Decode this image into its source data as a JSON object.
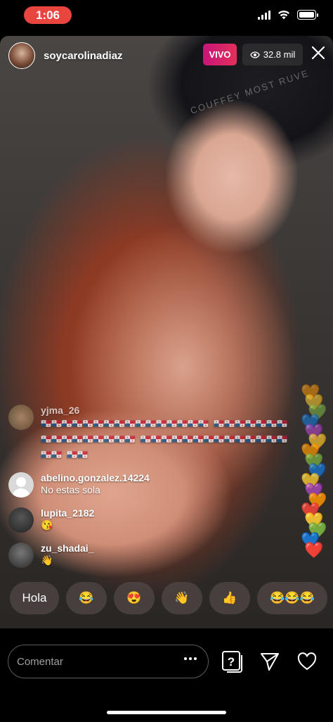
{
  "status": {
    "time": "1:06"
  },
  "stream": {
    "host_username": "soycarolinadiaz",
    "live_label": "VIVO",
    "viewer_count": "32.8 mil",
    "hat_text": "COUFFEY MOST RUVE"
  },
  "comments": [
    {
      "user": "yjma_26",
      "text": "🇵🇦🇵🇦🇵🇦🇵🇦🇵🇦🇵🇦🇵🇦🇵🇦🇵🇦🇵🇦🇵🇦🇵🇦🇵🇦🇵🇦🇵🇦🇵🇦 🇵🇦🇵🇦🇵🇦🇵🇦🇵🇦🇵🇦🇵🇦🇵🇦🇵🇦🇵🇦🇵🇦🇵🇦🇵🇦🇵🇦🇵🇦🇵🇦 🇵🇦🇵🇦🇵🇦🇵🇦🇵🇦🇵🇦🇵🇦🇵🇦🇵🇦🇵🇦🇵🇦🇵🇦🇵🇦🇵🇦🇵🇦🇵🇦 🇵🇦🇵🇦"
    },
    {
      "user": "abelino.gonzalez.14224",
      "text": "No estas sola"
    },
    {
      "user": "lupita_2182",
      "text": "😘"
    },
    {
      "user": "zu_shadai_",
      "text": "👋"
    }
  ],
  "quick_reactions": [
    "Hola",
    "😂",
    "😍",
    "👋",
    "👍",
    "😂😂😂"
  ],
  "composer": {
    "placeholder": "Comentar"
  },
  "hearts": [
    "🧡",
    "💛",
    "💚",
    "💙",
    "💜",
    "💛",
    "🧡",
    "💚",
    "💙",
    "💛",
    "💜",
    "🧡",
    "❤️",
    "💛",
    "💚",
    "💙",
    "❤️"
  ],
  "icons": {
    "close": "close-icon",
    "viewers": "eye-icon",
    "more": "more-icon",
    "question": "question-icon",
    "share": "send-icon",
    "like": "heart-icon"
  }
}
